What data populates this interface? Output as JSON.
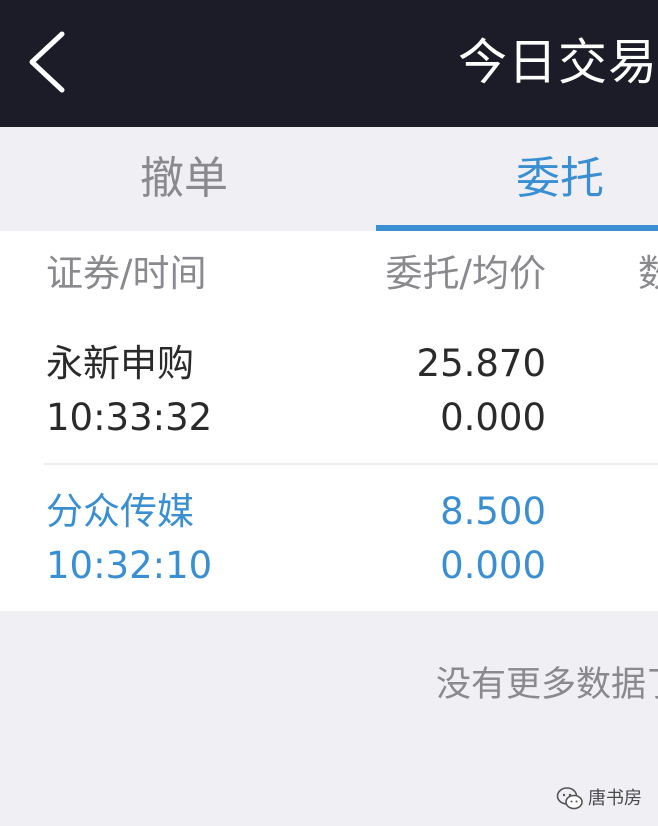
{
  "navbar": {
    "title": "今日交易",
    "back_icon": "chevron-left-icon",
    "background": "#1c1b28"
  },
  "tabs": [
    {
      "label": "撤单",
      "active": false
    },
    {
      "label": "委托",
      "active": true
    }
  ],
  "colors": {
    "accent": "#3a8fd2",
    "muted": "#8a8a8e",
    "text": "#2a2a2a"
  },
  "table": {
    "headers": [
      "证券/时间",
      "委托/均价",
      "数"
    ],
    "rows": [
      {
        "name": "永新申购",
        "time": "10:33:32",
        "price": "25.870",
        "avg_price": "0.000"
      },
      {
        "name": "分众传媒",
        "time": "10:32:10",
        "price": "8.500",
        "avg_price": "0.000"
      }
    ]
  },
  "footer": {
    "no_more": "没有更多数据了"
  },
  "watermark": {
    "text": "唐书房",
    "icon": "wechat-logo-icon"
  }
}
